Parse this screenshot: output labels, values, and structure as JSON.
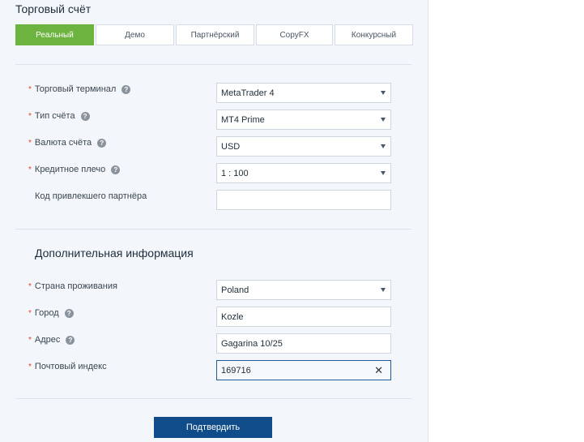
{
  "title": "Торговый счёт",
  "tabs": [
    {
      "label": "Реальный",
      "active": true
    },
    {
      "label": "Демо",
      "active": false
    },
    {
      "label": "Партнёрский",
      "active": false
    },
    {
      "label": "CopyFX",
      "active": false
    },
    {
      "label": "Конкурсный",
      "active": false
    }
  ],
  "account": {
    "terminal": {
      "label": "Торговый терминал",
      "value": "MetaTrader 4",
      "icon": "help-icon"
    },
    "type": {
      "label": "Тип счёта",
      "value": "MT4 Prime",
      "icon": "help-icon"
    },
    "currency": {
      "label": "Валюта счёта",
      "value": "USD",
      "icon": "help-icon"
    },
    "leverage": {
      "label": "Кредитное плечо",
      "value": "1 : 100",
      "icon": "help-icon"
    },
    "partner_code": {
      "label": "Код привлекшего партнёра",
      "value": ""
    }
  },
  "additional": {
    "heading": "Дополнительная информация",
    "country": {
      "label": "Страна проживания",
      "value": "Poland"
    },
    "city": {
      "label": "Город",
      "value": "Kozle",
      "icon": "help-icon"
    },
    "address": {
      "label": "Адрес",
      "value": "Gagarina 10/25",
      "icon": "help-icon"
    },
    "postcode": {
      "label": "Почтовый индекс",
      "value": "169716",
      "icon": "close-icon"
    }
  },
  "required_marker": "*",
  "submit_label": "Подтвердить",
  "colors": {
    "active_tab": "#6cb33f",
    "submit": "#0f4c89",
    "required": "#e8432a"
  }
}
